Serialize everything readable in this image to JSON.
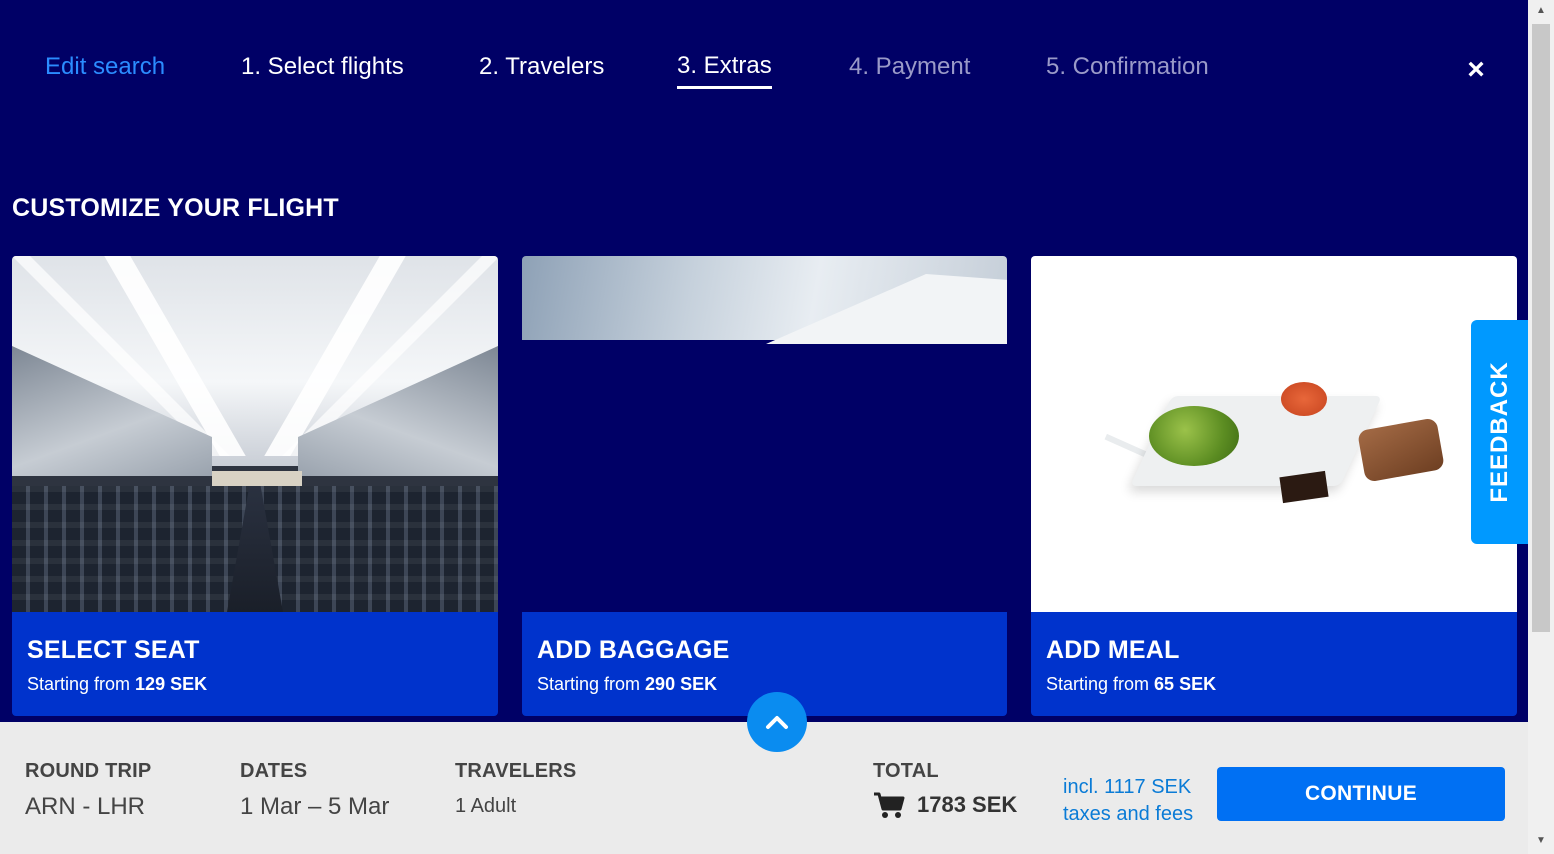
{
  "nav": {
    "edit": "Edit search",
    "steps": [
      "1. Select flights",
      "2. Travelers",
      "3. Extras",
      "4. Payment",
      "5. Confirmation"
    ],
    "active_step": "3. Extras",
    "close": "×"
  },
  "section_title": "CUSTOMIZE YOUR FLIGHT",
  "cards": [
    {
      "title": "SELECT SEAT",
      "price_prefix": "Starting from ",
      "price": "129 SEK"
    },
    {
      "title": "ADD BAGGAGE",
      "price_prefix": "Starting from ",
      "price": "290 SEK"
    },
    {
      "title": "ADD MEAL",
      "price_prefix": "Starting from ",
      "price": "65 SEK"
    }
  ],
  "feedback": "FEEDBACK",
  "summary": {
    "trip_label": "ROUND TRIP",
    "trip_value": "ARN - LHR",
    "dates_label": "DATES",
    "dates_value": "1 Mar – 5 Mar",
    "travelers_label": "TRAVELERS",
    "travelers_value": "1 Adult",
    "total_label": "TOTAL",
    "total_value": "1783 SEK",
    "fees_line1": "incl. 1117 SEK",
    "fees_line2": "taxes and fees",
    "continue": "CONTINUE"
  },
  "icons": {
    "close": "close-icon",
    "cart": "cart-icon",
    "expand": "chevron-up-icon"
  },
  "colors": {
    "background": "#000066",
    "card_footer": "#0033cc",
    "accent": "#0070f3",
    "feedback": "#0099ff",
    "link": "#2b8cff"
  }
}
